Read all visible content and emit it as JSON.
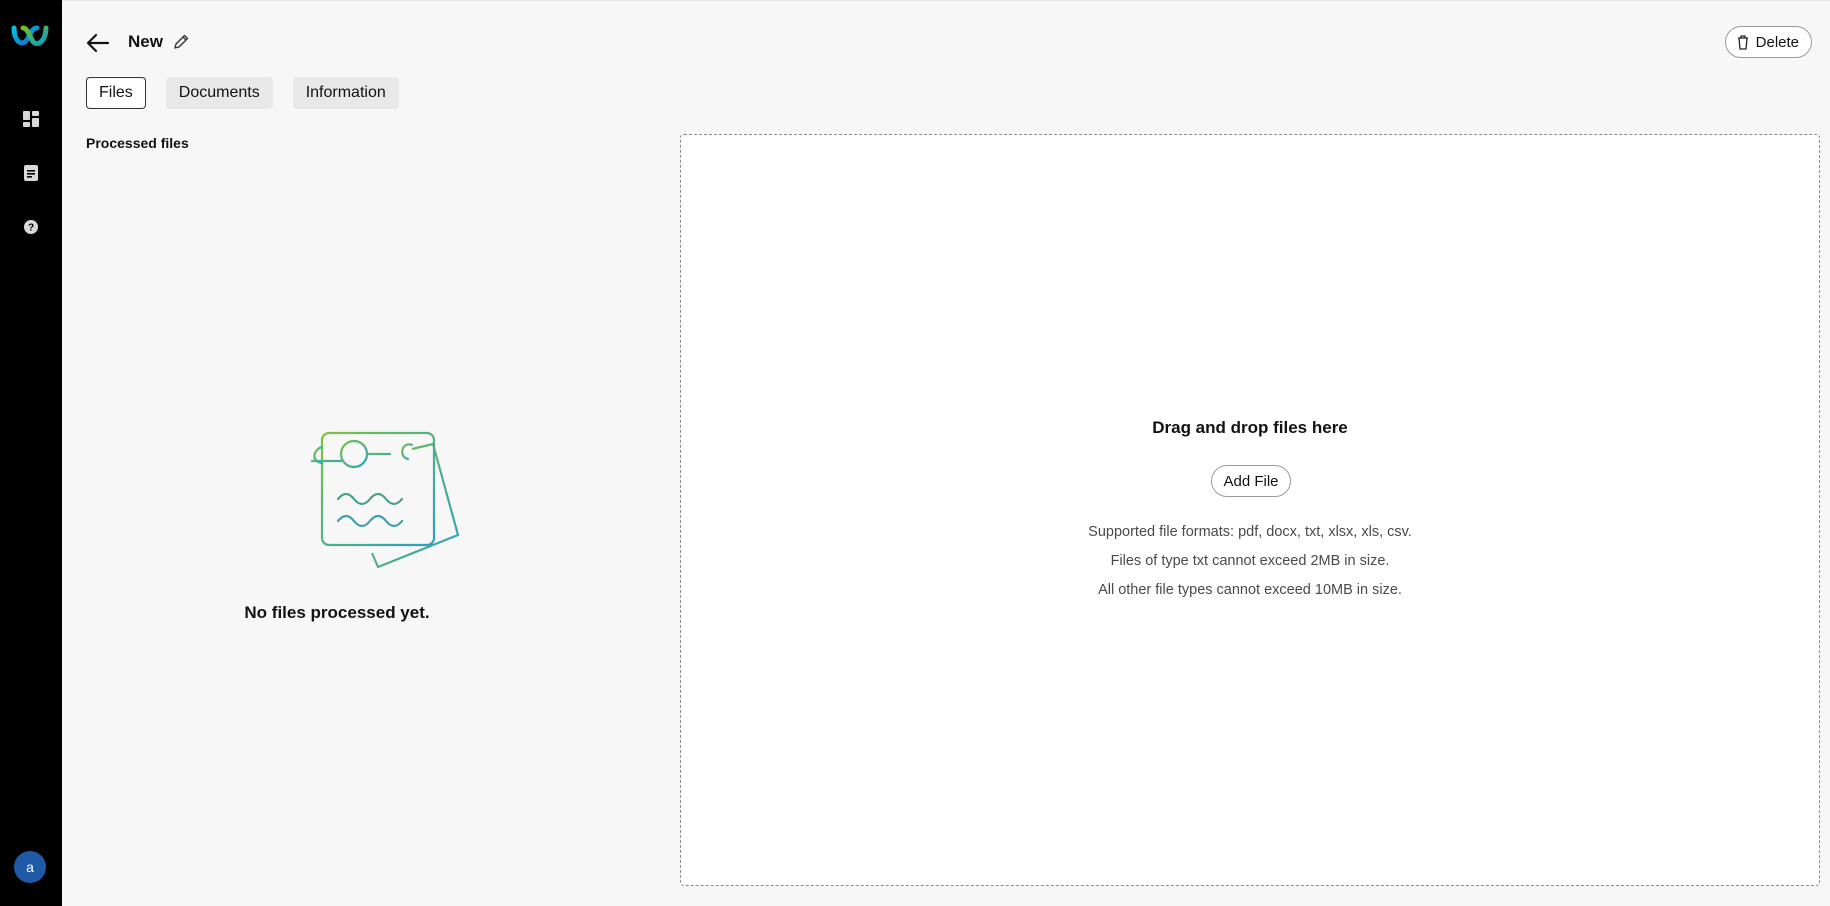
{
  "header": {
    "title": "New",
    "delete_label": "Delete"
  },
  "tabs": [
    {
      "label": "Files",
      "active": true
    },
    {
      "label": "Documents",
      "active": false
    },
    {
      "label": "Information",
      "active": false
    }
  ],
  "left_panel": {
    "section_label": "Processed files",
    "empty_message": "No files processed yet."
  },
  "dropzone": {
    "title": "Drag and drop files here",
    "add_button_label": "Add File",
    "lines": [
      "Supported file formats: pdf, docx, txt, xlsx, xls, csv.",
      "Files of type txt cannot exceed 2MB in size.",
      "All other file types cannot exceed 10MB in size."
    ]
  },
  "sidebar": {
    "items": [
      {
        "icon": "dashboard-icon"
      },
      {
        "icon": "document-icon"
      },
      {
        "icon": "help-icon"
      }
    ],
    "avatar_initial": "a"
  },
  "colors": {
    "sidebar_bg": "#000000",
    "avatar_bg": "#1f5aa6",
    "illustration_green": "#7cc242",
    "illustration_teal": "#2a9fc4"
  }
}
